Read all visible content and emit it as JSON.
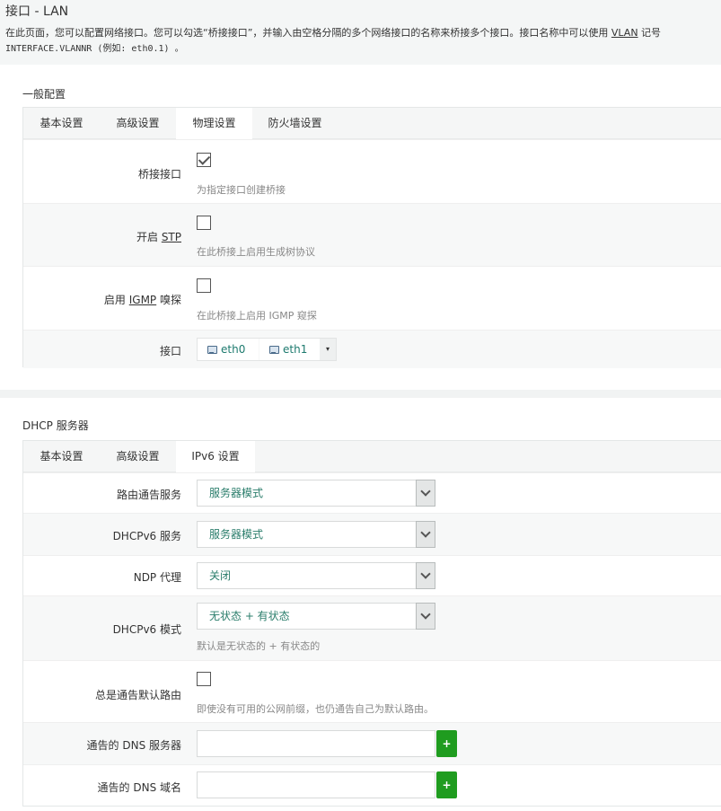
{
  "header": {
    "title": "接口 - LAN",
    "desc_line1_a": "在此页面，您可以配置网络接口。您可以勾选“桥接接口”，并输入由空格分隔的多个网络接口的名称来桥接多个接口。接口名称中可以使用 ",
    "desc_line1_link": "VLAN",
    "desc_line1_b": " 记号",
    "desc_line2": "INTERFACE.VLANNR (例如: eth0.1) 。"
  },
  "general": {
    "title": "一般配置",
    "tabs": [
      {
        "label": "基本设置"
      },
      {
        "label": "高级设置"
      },
      {
        "label": "物理设置"
      },
      {
        "label": "防火墙设置"
      }
    ],
    "bridge": {
      "label": "桥接接口",
      "checked": true,
      "hint": "为指定接口创建桥接"
    },
    "stp": {
      "label_a": "开启 ",
      "label_link": "STP",
      "checked": false,
      "hint": "在此桥接上启用生成树协议"
    },
    "igmp": {
      "label_a": "启用 ",
      "label_link": "IGMP",
      "label_b": " 嗅探",
      "checked": false,
      "hint": "在此桥接上启用 IGMP 窥探"
    },
    "interfaces": {
      "label": "接口",
      "items": [
        "eth0",
        "eth1"
      ],
      "caret": "▾"
    }
  },
  "dhcp": {
    "title": "DHCP 服务器",
    "tabs": [
      {
        "label": "基本设置"
      },
      {
        "label": "高级设置"
      },
      {
        "label": "IPv6 设置"
      }
    ],
    "ra": {
      "label": "路由通告服务",
      "value": "服务器模式"
    },
    "dhcpv6": {
      "label": "DHCPv6 服务",
      "value": "服务器模式"
    },
    "ndp": {
      "label": "NDP 代理",
      "value": "关闭"
    },
    "mode": {
      "label": "DHCPv6 模式",
      "value": "无状态 + 有状态",
      "hint": "默认是无状态的 + 有状态的"
    },
    "default_route": {
      "label": "总是通告默认路由",
      "checked": false,
      "hint": "即使没有可用的公网前缀，也仍通告自己为默认路由。"
    },
    "dns_server": {
      "label": "通告的 DNS 服务器",
      "value": "",
      "add": "+"
    },
    "dns_domain": {
      "label": "通告的 DNS 域名",
      "value": "",
      "add": "+"
    }
  },
  "colors": {
    "accent": "#1f9c1f",
    "value_text": "#2a7d6b"
  }
}
